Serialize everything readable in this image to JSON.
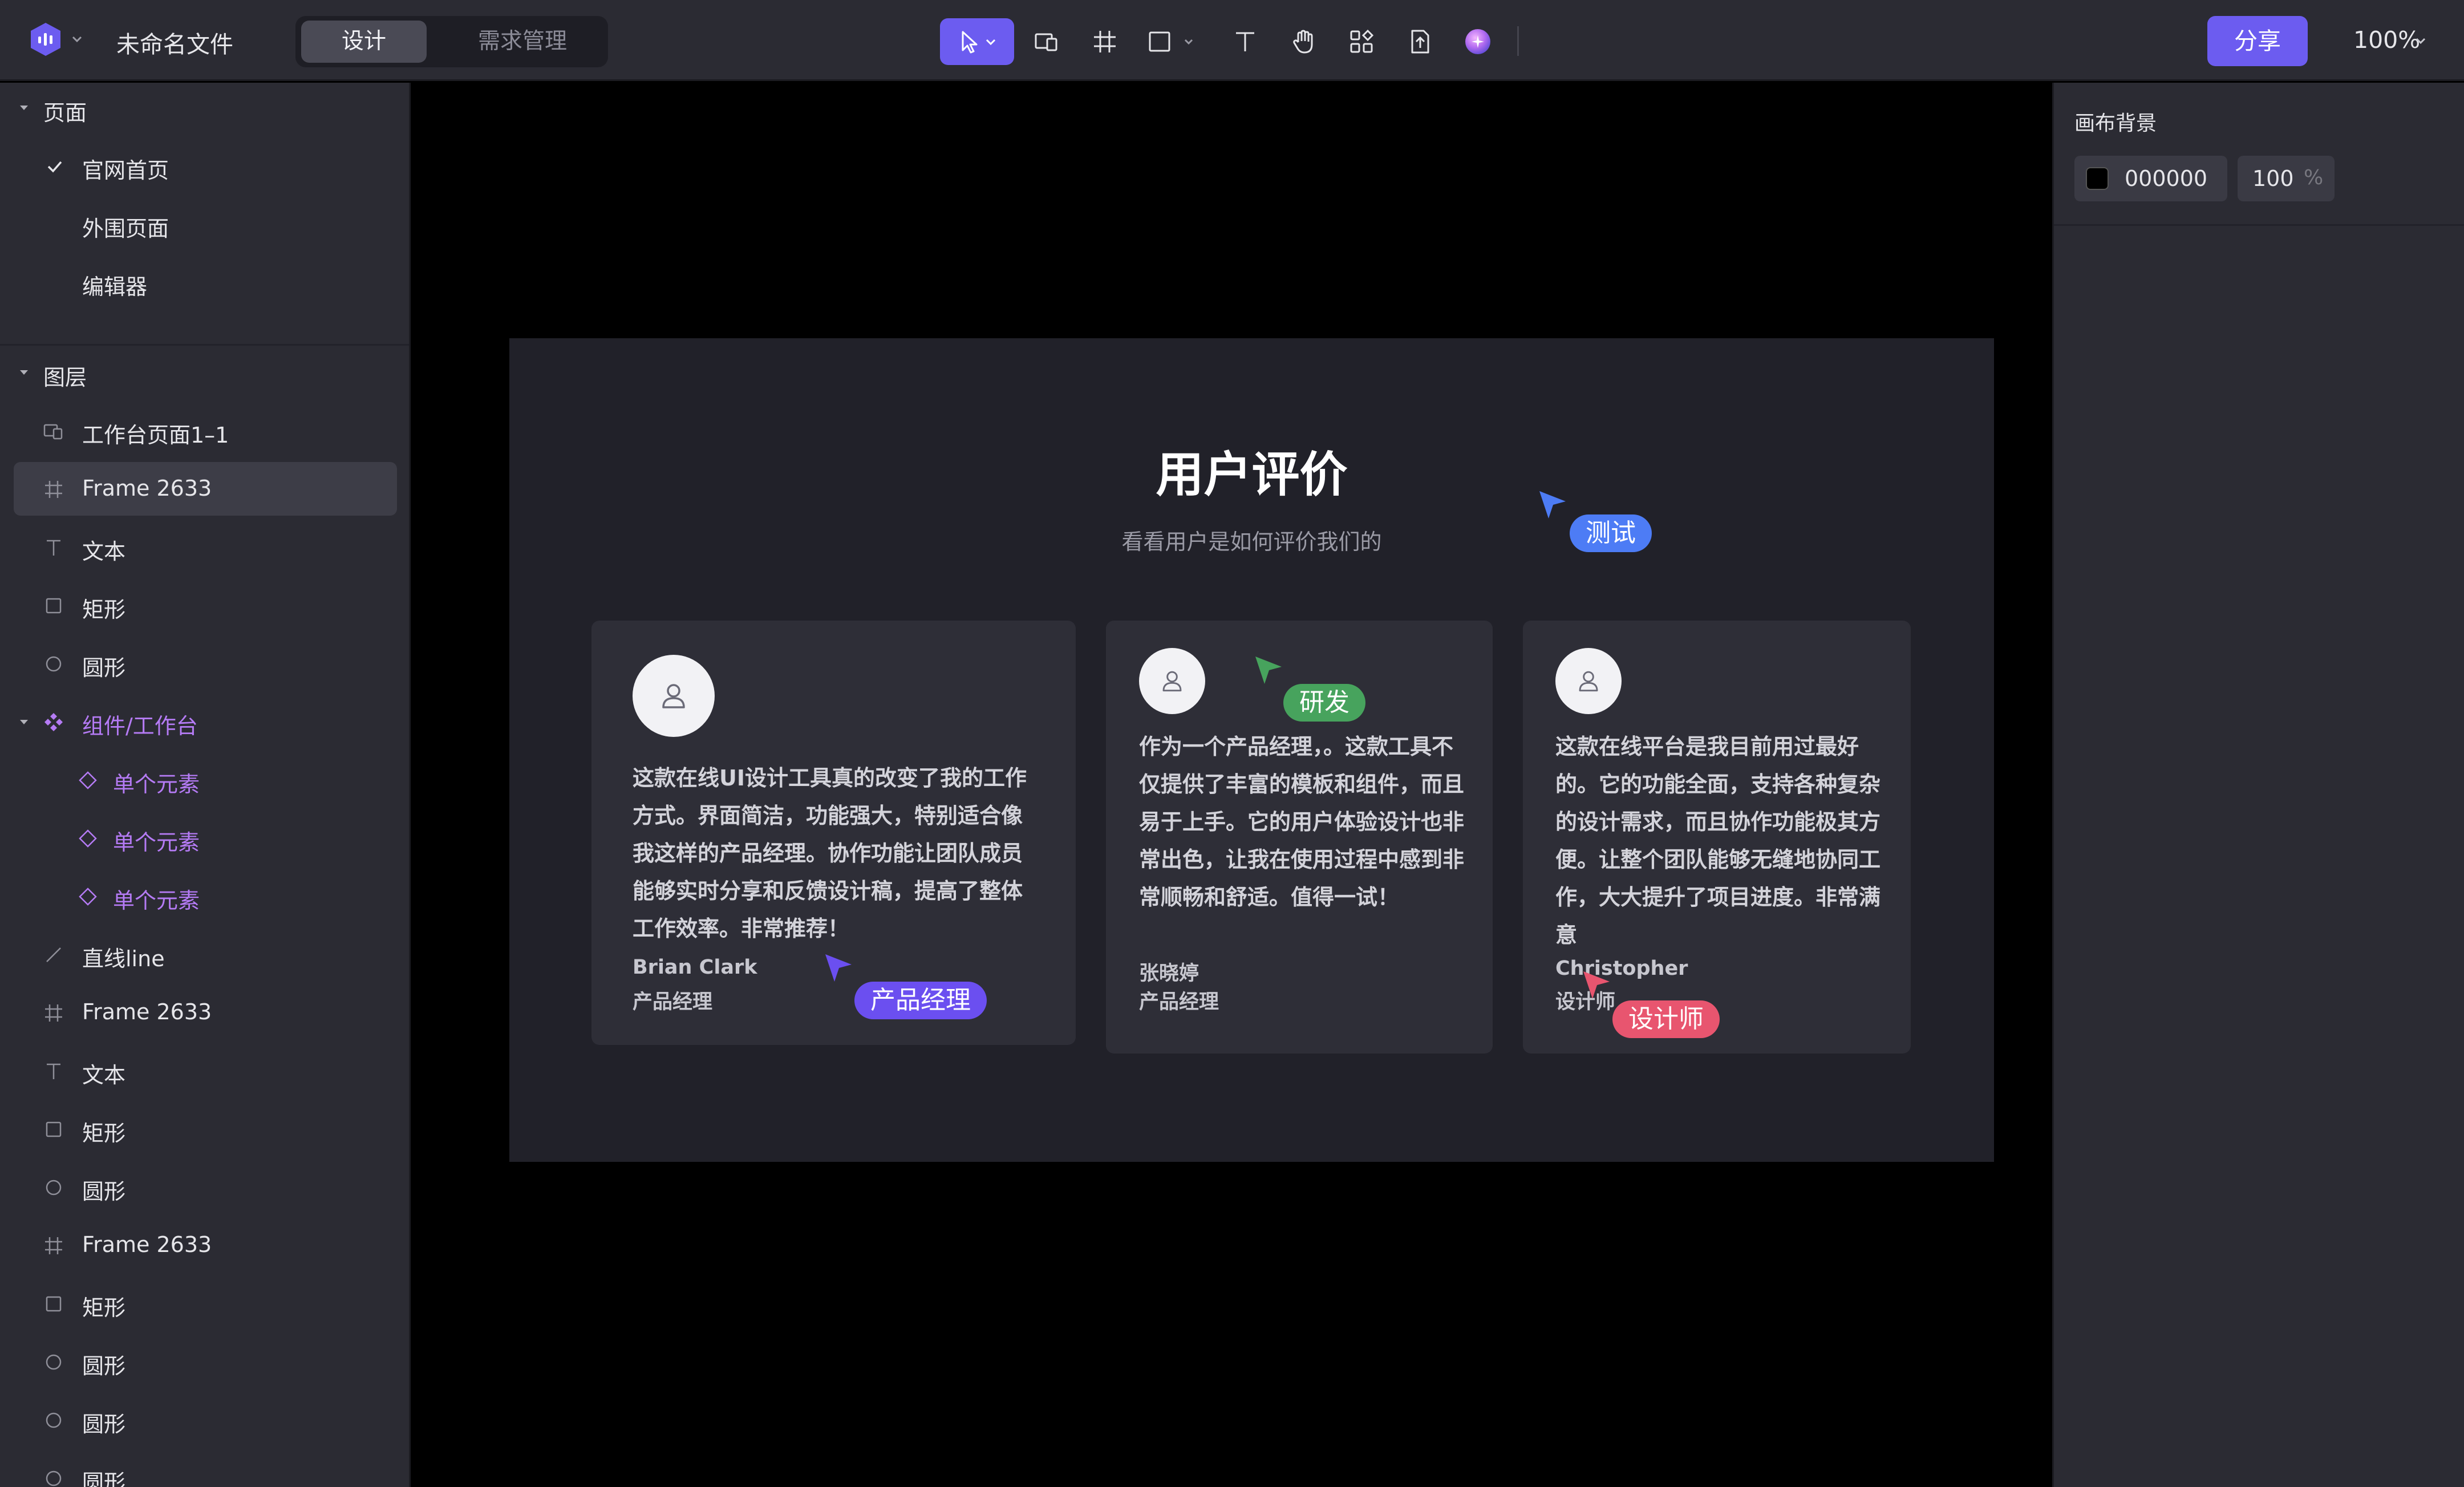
{
  "topbar": {
    "file_title": "未命名文件",
    "mode_tabs": [
      {
        "label": "设计",
        "active": true
      },
      {
        "label": "需求管理",
        "active": false
      }
    ],
    "tools": [
      "select-tool",
      "device-frame-tool",
      "frame-tool",
      "rectangle-tool",
      "text-tool",
      "hand-tool",
      "components-tool",
      "export-tool",
      "ai-plugin"
    ],
    "active_tool": "select-tool",
    "share_label": "分享",
    "zoom": "100%",
    "accent": "#6c5cf0"
  },
  "left_panel": {
    "pages_title": "页面",
    "pages": [
      {
        "label": "官网首页",
        "current": true
      },
      {
        "label": "外围页面",
        "current": false
      },
      {
        "label": "编辑器",
        "current": false
      }
    ],
    "layers_title": "图层",
    "layers": [
      {
        "label": "工作台页面1–1",
        "icon": "device-icon"
      },
      {
        "label": "Frame 2633",
        "icon": "frame-icon",
        "selected": true
      },
      {
        "label": "文本",
        "icon": "text-icon"
      },
      {
        "label": "矩形",
        "icon": "rectangle-icon"
      },
      {
        "label": "圆形",
        "icon": "ellipse-icon"
      },
      {
        "label": "组件/工作台",
        "icon": "component-icon",
        "expanded": true
      },
      {
        "label": "单个元素",
        "icon": "instance-icon"
      },
      {
        "label": "单个元素",
        "icon": "instance-icon"
      },
      {
        "label": "单个元素",
        "icon": "instance-icon"
      },
      {
        "label": "直线line",
        "icon": "line-icon"
      },
      {
        "label": "Frame 2633",
        "icon": "frame-icon"
      },
      {
        "label": "文本",
        "icon": "text-icon"
      },
      {
        "label": "矩形",
        "icon": "rectangle-icon"
      },
      {
        "label": "圆形",
        "icon": "ellipse-icon"
      },
      {
        "label": "Frame 2633",
        "icon": "frame-icon"
      },
      {
        "label": "矩形",
        "icon": "rectangle-icon"
      },
      {
        "label": "圆形",
        "icon": "ellipse-icon"
      },
      {
        "label": "圆形",
        "icon": "ellipse-icon"
      },
      {
        "label": "圆形",
        "icon": "ellipse-icon"
      }
    ],
    "component_color": "#b57bf5"
  },
  "right_panel": {
    "title": "画布背景",
    "color_hex": "000000",
    "opacity": "100",
    "opacity_unit": "%"
  },
  "canvas": {
    "frame": {
      "title": "用户评价",
      "subtitle": "看看用户是如何评价我们的",
      "cards": [
        {
          "quote": "这款在线UI设计工具真的改变了我的工作方式。界面简洁，功能强大，特别适合像我这样的产品经理。协作功能让团队成员能够实时分享和反馈设计稿，提高了整体工作效率。非常推荐！",
          "author": "Brian Clark",
          "role": "产品经理"
        },
        {
          "quote": "作为一个产品经理，。这款工具不仅提供了丰富的模板和组件，而且易于上手。它的用户体验设计也非常出色，让我在使用过程中感到非常顺畅和舒适。值得一试！",
          "author": "张晓婷",
          "role": "产品经理"
        },
        {
          "quote": "这款在线平台是我目前用过最好的。它的功能全面，支持各种复杂的设计需求，而且协作功能极其方便。让整个团队能够无缝地协同工作，大大提升了项目进度。非常满意",
          "author": "Christopher",
          "role": "设计师"
        }
      ]
    },
    "collaborators": [
      {
        "name": "测试",
        "color": "#4d7cf5"
      },
      {
        "name": "研发",
        "color": "#47a35d"
      },
      {
        "name": "产品经理",
        "color": "#6b4ff0"
      },
      {
        "name": "设计师",
        "color": "#e8556f"
      }
    ]
  }
}
